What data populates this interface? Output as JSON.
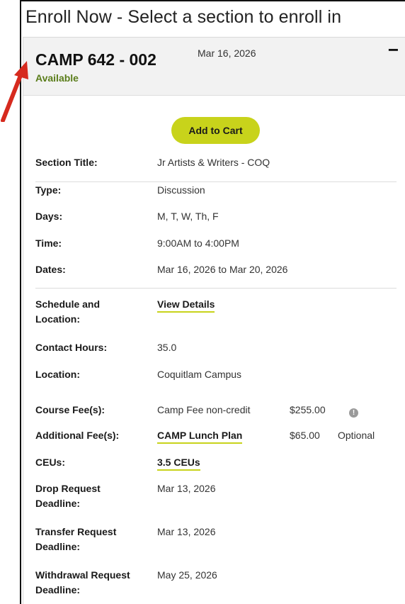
{
  "page": {
    "title": "Enroll Now - Select a section to enroll in"
  },
  "section": {
    "code": "CAMP 642 - 002",
    "date": "Mar 16, 2026",
    "status": "Available",
    "collapse_icon": "−",
    "add_to_cart_label": "Add to Cart"
  },
  "details": {
    "section_title": {
      "label": "Section Title:",
      "value": "Jr Artists & Writers - COQ"
    },
    "type": {
      "label": "Type:",
      "value": "Discussion"
    },
    "days": {
      "label": "Days:",
      "value": "M, T, W, Th, F"
    },
    "time": {
      "label": "Time:",
      "value": "9:00AM to 4:00PM"
    },
    "dates": {
      "label": "Dates:",
      "value": "Mar 16, 2026 to Mar 20, 2026"
    },
    "schedule": {
      "label_line1": "Schedule and",
      "label_line2": "Location:",
      "link": "View Details"
    },
    "contact_hours": {
      "label": "Contact Hours:",
      "value": "35.0"
    },
    "location": {
      "label": "Location:",
      "value": "Coquitlam Campus"
    },
    "course_fee": {
      "label": "Course Fee(s):",
      "name": "Camp Fee non-credit",
      "amount": "$255.00",
      "info_icon": "!"
    },
    "additional_fee": {
      "label": "Additional Fee(s):",
      "link": "CAMP Lunch Plan",
      "amount": "$65.00",
      "note": "Optional"
    },
    "ceus": {
      "label": "CEUs:",
      "link": "3.5 CEUs"
    },
    "drop_deadline": {
      "label_line1": "Drop Request",
      "label_line2": "Deadline:",
      "value": "Mar 13, 2026"
    },
    "transfer_deadline": {
      "label_line1": "Transfer Request",
      "label_line2": "Deadline:",
      "value": "Mar 13, 2026"
    },
    "withdrawal_deadline": {
      "label_line1": "Withdrawal Request",
      "label_line2": "Deadline:",
      "value": "May 25, 2026"
    }
  },
  "colors": {
    "accent": "#c8d31b",
    "status_green": "#5a7d1a",
    "arrow_red": "#d62a1e"
  }
}
